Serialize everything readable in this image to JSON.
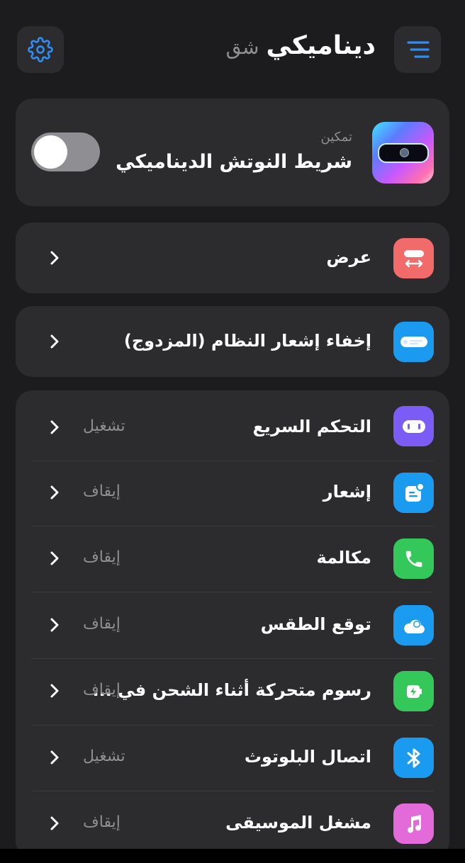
{
  "header": {
    "title": "ديناميكي",
    "subtitle": "شق",
    "menu_icon": "menu-icon",
    "settings_icon": "gear-icon"
  },
  "enable_card": {
    "small_label": "تمكين",
    "title": "شريط النوتش الديناميكي",
    "toggle_on": false,
    "icon": "notch-preview-icon"
  },
  "display_row": {
    "label": "عرض",
    "icon": "width-icon",
    "icon_color": "#f26b6b"
  },
  "hide_row": {
    "label": "إخفاء إشعار النظام (المزدوج)",
    "icon": "notification-bar-icon",
    "icon_color": "#1a9bf0"
  },
  "features": [
    {
      "label": "التحكم السريع",
      "value": "تشغيل",
      "icon": "quick-control-icon",
      "icon_color": "#7b5cf5"
    },
    {
      "label": "إشعار",
      "value": "إيقاف",
      "icon": "notification-icon",
      "icon_color": "#1a9bf0"
    },
    {
      "label": "مكالمة",
      "value": "إيقاف",
      "icon": "phone-icon",
      "icon_color": "#34c759"
    },
    {
      "label": "توقع الطقس",
      "value": "إيقاف",
      "icon": "weather-icon",
      "icon_color": "#1a9bf0"
    },
    {
      "label": "رسوم متحركة أثناء الشحن في ...",
      "value": "إيقاف",
      "icon": "battery-charging-icon",
      "icon_color": "#34c759"
    },
    {
      "label": "اتصال البلوتوث",
      "value": "تشغيل",
      "icon": "bluetooth-icon",
      "icon_color": "#1a9bf0"
    },
    {
      "label": "مشغل الموسيقى",
      "value": "إيقاف",
      "icon": "music-icon",
      "icon_color": "#e36bd9"
    }
  ]
}
